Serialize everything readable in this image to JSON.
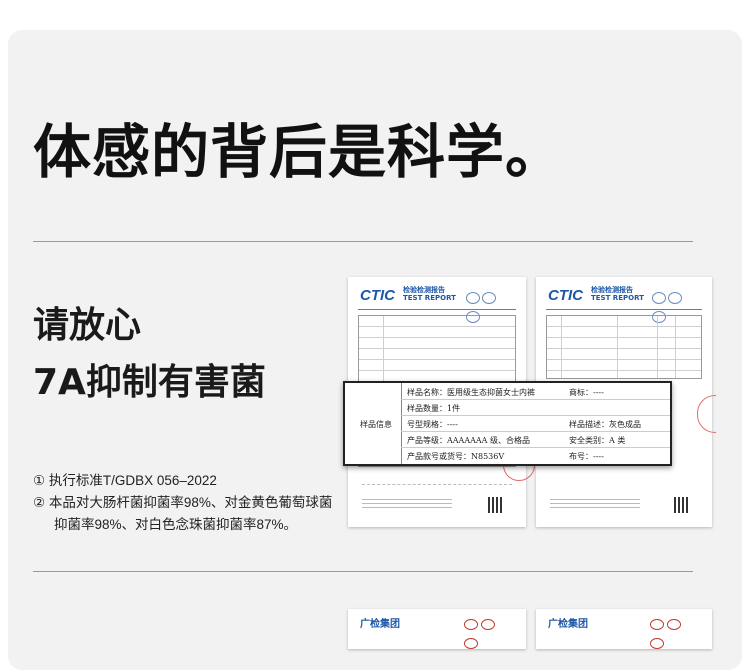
{
  "headline": "体感的背后是科学。",
  "section_title_line1": "请放心",
  "section_title_line2": "7A抑制有害菌",
  "notes": {
    "line1": "① 执行标准T/GDBX 056–2022",
    "line2": "② 本品对大肠杆菌抑菌率98%、对金黄色葡萄球菌",
    "line3": "抑菌率98%、对白色念珠菌抑菌率87%。"
  },
  "report": {
    "brand": "CTIC",
    "title_cn": "检验检测报告",
    "title_en": "TEST REPORT"
  },
  "zoomed_table": {
    "row_label": "样品信息",
    "sample_name_label": "样品名称：",
    "sample_name_value": "医用级生态抑菌女士内裤",
    "trademark": "商标：----",
    "sample_qty": "样品数量：1件",
    "model": "号型规格：----",
    "description": "样品描述：灰色成品",
    "grade": "产品等级：AAAAAAA 级、合格品",
    "safety": "安全类别：A 类",
    "article": "产品款号或货号：N8536V",
    "fabric_no": "布号：----"
  },
  "report2": {
    "brand": "广检集团"
  }
}
